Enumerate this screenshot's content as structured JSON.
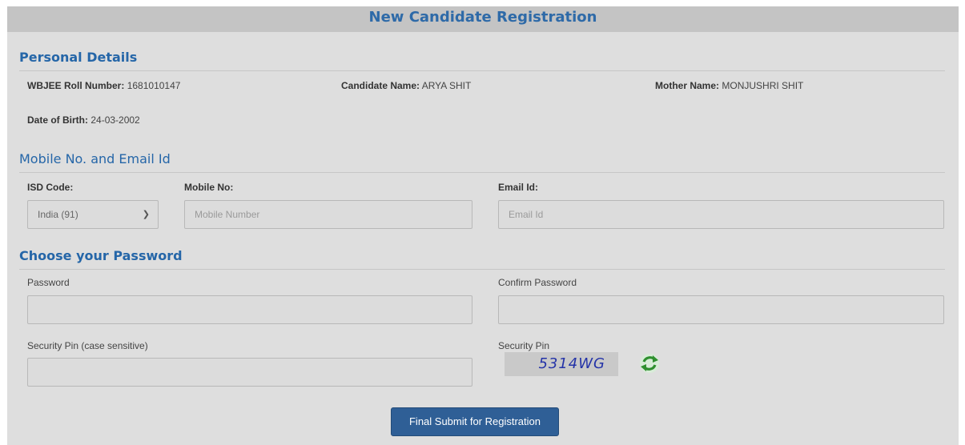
{
  "header": {
    "title": "New Candidate Registration"
  },
  "personal": {
    "title": "Personal Details",
    "roll_label": "WBJEE Roll Number",
    "roll_value": "1681010147",
    "name_label": "Candidate Name",
    "name_value": "ARYA SHIT",
    "mother_label": "Mother Name",
    "mother_value": "MONJUSHRI SHIT",
    "dob_label": "Date of Birth",
    "dob_value": "24-03-2002"
  },
  "contact": {
    "title": "Mobile No. and Email Id",
    "isd_label": "ISD Code:",
    "isd_value": "India (91)",
    "mobile_label": "Mobile No:",
    "mobile_placeholder": "Mobile Number",
    "email_label": "Email Id:",
    "email_placeholder": "Email Id"
  },
  "password": {
    "title": "Choose your Password",
    "password_label": "Password",
    "confirm_label": "Confirm Password",
    "pin_label": "Security Pin (case sensitive)",
    "captcha_label": "Security Pin",
    "captcha_text": "5314WG"
  },
  "submit_label": "Final Submit for Registration",
  "colors": {
    "accent": "#2566a8",
    "button": "#2f5f96",
    "refresh": "#3a9a3a"
  },
  "icons": {
    "isd_dropdown": "chevron-down-icon",
    "refresh": "refresh-icon"
  }
}
